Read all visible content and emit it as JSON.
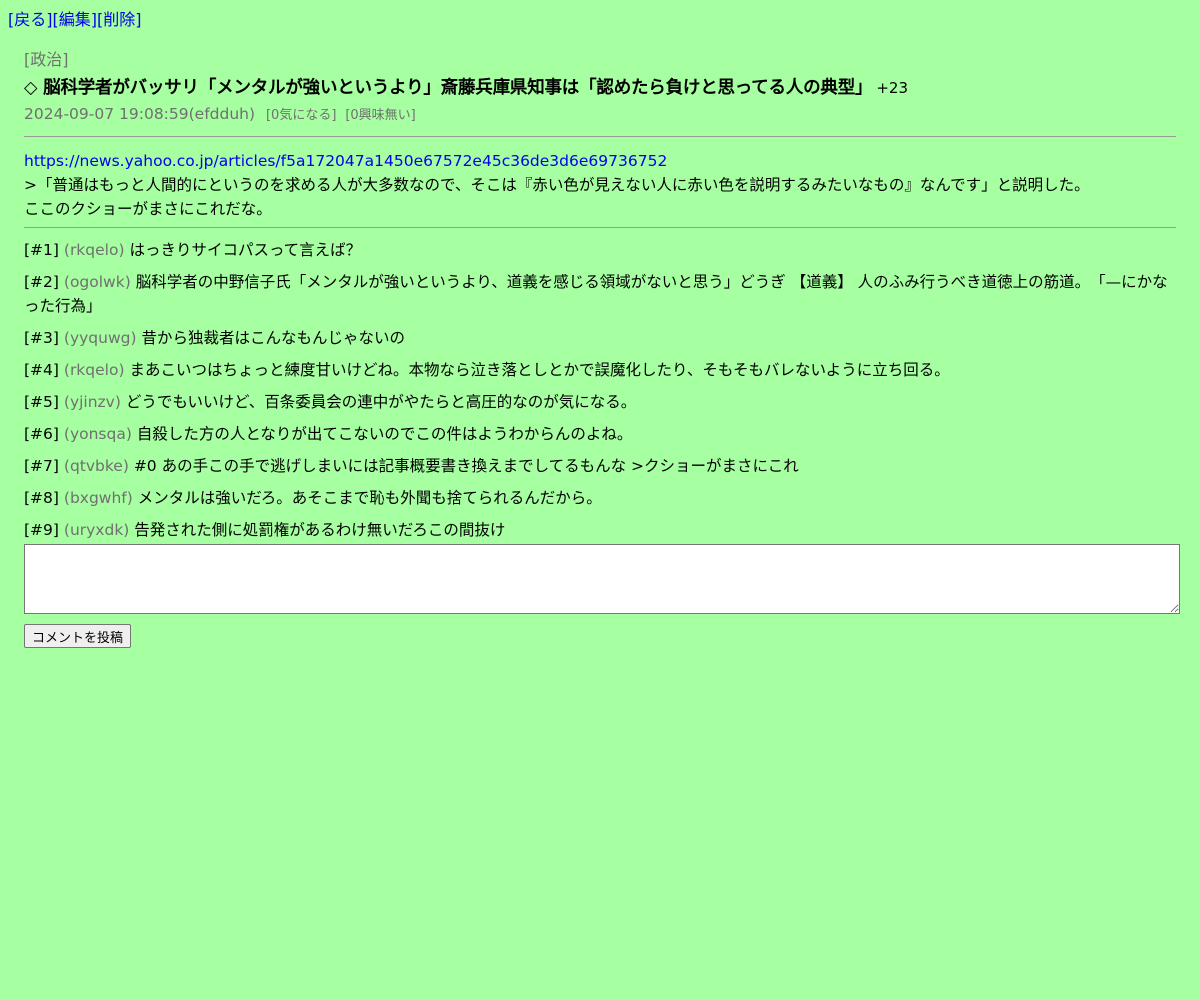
{
  "nav": {
    "back": "[戻る]",
    "edit": "[編集]",
    "delete": "[削除]"
  },
  "post": {
    "category": "[政治]",
    "title": "◇ 脳科学者がバッサリ「メンタルが強いというより」斎藤兵庫県知事は「認めたら負けと思ってる人の典型」",
    "score": "+23",
    "datetime": "2024-09-07 19:08:59",
    "author": "(efdduh)",
    "concern_tag": "[0気になる]",
    "nointerest_tag": "[0興味無い]",
    "link": "https://news.yahoo.co.jp/articles/f5a172047a1450e67572e45c36de3d6e69736752",
    "body_lines": [
      ">「普通はもっと人間的にというのを求める人が大多数なので、そこは『赤い色が見えない人に赤い色を説明するみたいなもの』なんです」と説明した。",
      "ここのクショーがまさにこれだな。"
    ]
  },
  "comments": [
    {
      "num": "[#1]",
      "user": "(rkqelo)",
      "text": "はっきりサイコパスって言えば？"
    },
    {
      "num": "[#2]",
      "user": "(ogolwk)",
      "text": "脳科学者の中野信子氏「メンタルが強いというより、道義を感じる領域がないと思う」どうぎ 【道義】 人のふみ行うべき道徳上の筋道。　「—にかなった行為」"
    },
    {
      "num": "[#3]",
      "user": "(yyquwg)",
      "text": "昔から独裁者はこんなもんじゃないの"
    },
    {
      "num": "[#4]",
      "user": "(rkqelo)",
      "text": "まあこいつはちょっと練度甘いけどね。本物なら泣き落としとかで誤魔化したり、そもそもバレないように立ち回る。"
    },
    {
      "num": "[#5]",
      "user": "(yjinzv)",
      "text": "どうでもいいけど、百条委員会の連中がやたらと高圧的なのが気になる。"
    },
    {
      "num": "[#6]",
      "user": "(yonsqa)",
      "text": "自殺した方の人となりが出てこないのでこの件はようわからんのよね。"
    },
    {
      "num": "[#7]",
      "user": "(qtvbke)",
      "text": "#0 あの手この手で逃げしまいには記事概要書き換えまでしてるもんな >クショーがまさにこれ"
    },
    {
      "num": "[#8]",
      "user": "(bxgwhf)",
      "text": "メンタルは強いだろ。あそこまで恥も外聞も捨てられるんだから。"
    },
    {
      "num": "[#9]",
      "user": "(uryxdk)",
      "text": "告発された側に処罰権があるわけ無いだろこの間抜け"
    }
  ],
  "form": {
    "textarea_value": "",
    "submit_label": "コメントを投稿"
  }
}
